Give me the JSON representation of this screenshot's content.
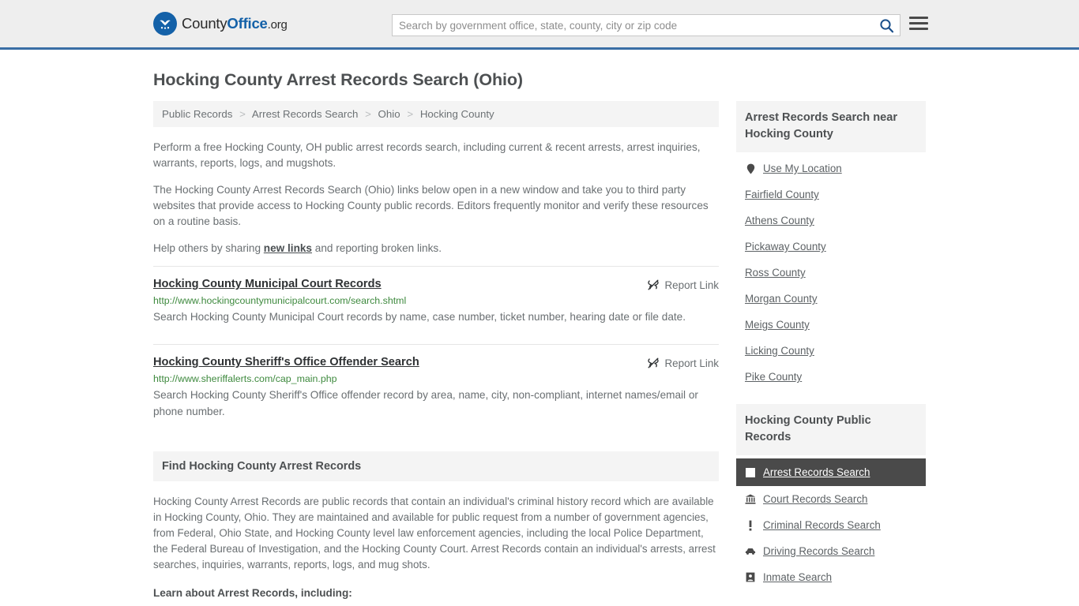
{
  "header": {
    "logo": {
      "icon": "eagle-shield-icon",
      "text_county": "County",
      "text_office": "Office",
      "text_org": ".org"
    },
    "search": {
      "placeholder": "Search by government office, state, county, city or zip code",
      "value": "",
      "search_icon": "search-icon"
    },
    "menu_icon": "hamburger-menu-icon"
  },
  "page": {
    "title": "Hocking County Arrest Records Search (Ohio)"
  },
  "breadcrumb": {
    "separator": ">",
    "items": [
      {
        "label": "Public Records"
      },
      {
        "label": "Arrest Records Search"
      },
      {
        "label": "Ohio"
      },
      {
        "label": "Hocking County"
      }
    ]
  },
  "intro": {
    "p1": "Perform a free Hocking County, OH public arrest records search, including current & recent arrests, arrest inquiries, warrants, reports, logs, and mugshots.",
    "p2": "The Hocking County Arrest Records Search (Ohio) links below open in a new window and take you to third party websites that provide access to Hocking County public records. Editors frequently monitor and verify these resources on a routine basis.",
    "p3_before": "Help others by sharing ",
    "p3_link": "new links",
    "p3_after": " and reporting broken links."
  },
  "results": [
    {
      "title": "Hocking County Municipal Court Records",
      "url": "http://www.hockingcountymunicipalcourt.com/search.shtml",
      "description": "Search Hocking County Municipal Court records by name, case number, ticket number, hearing date or file date.",
      "report_label": "Report Link",
      "report_icon": "broken-link-icon"
    },
    {
      "title": "Hocking County Sheriff's Office Offender Search",
      "url": "http://www.sheriffalerts.com/cap_main.php",
      "description": "Search Hocking County Sheriff's Office offender record by area, name, city, non-compliant, internet names/email or phone number.",
      "report_label": "Report Link",
      "report_icon": "broken-link-icon"
    }
  ],
  "find_section": {
    "heading": "Find Hocking County Arrest Records",
    "body": "Hocking County Arrest Records are public records that contain an individual's criminal history record which are available in Hocking County, Ohio. They are maintained and available for public request from a number of government agencies, from Federal, Ohio State, and Hocking County level law enforcement agencies, including the local Police Department, the Federal Bureau of Investigation, and the Hocking County Court. Arrest Records contain an individual's arrests, arrest searches, inquiries, warrants, reports, logs, and mug shots.",
    "subheading": "Learn about Arrest Records, including:"
  },
  "sidebar": {
    "near_box": {
      "heading": "Arrest Records Search near Hocking County",
      "items": [
        {
          "label": "Use My Location",
          "icon": "map-pin-icon"
        },
        {
          "label": "Fairfield County",
          "icon": ""
        },
        {
          "label": "Athens County",
          "icon": ""
        },
        {
          "label": "Pickaway County",
          "icon": ""
        },
        {
          "label": "Ross County",
          "icon": ""
        },
        {
          "label": "Morgan County",
          "icon": ""
        },
        {
          "label": "Meigs County",
          "icon": ""
        },
        {
          "label": "Licking County",
          "icon": ""
        },
        {
          "label": "Pike County",
          "icon": ""
        }
      ]
    },
    "public_records_box": {
      "heading": "Hocking County Public Records",
      "items": [
        {
          "label": "Arrest Records Search",
          "icon": "square-icon",
          "active": true
        },
        {
          "label": "Court Records Search",
          "icon": "bank-building-icon",
          "active": false
        },
        {
          "label": "Criminal Records Search",
          "icon": "exclamation-icon",
          "active": false
        },
        {
          "label": "Driving Records Search",
          "icon": "car-icon",
          "active": false
        },
        {
          "label": "Inmate Search",
          "icon": "inmate-icon",
          "active": false
        }
      ]
    }
  },
  "colors": {
    "brand_blue": "#1461a8",
    "header_border": "#3a6ea5",
    "url_green": "#3f8a3f",
    "active_row": "#4a4a4a",
    "panel_gray": "#f4f4f4"
  }
}
